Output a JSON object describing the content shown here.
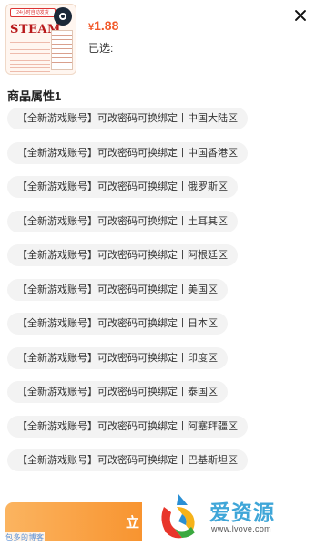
{
  "header": {
    "thumb_banner": "24小时自动发货",
    "thumb_title": "STEAM",
    "price_symbol": "¥",
    "price_value": "1.88",
    "selected_label": "已选:"
  },
  "attributes": {
    "title": "商品属性1",
    "options": [
      "【全新游戏账号】可改密码可换绑定丨中国大陆区",
      "【全新游戏账号】可改密码可换绑定丨中国香港区",
      "【全新游戏账号】可改密码可换绑定丨俄罗斯区",
      "【全新游戏账号】可改密码可换绑定丨土耳其区",
      "【全新游戏账号】可改密码可换绑定丨阿根廷区",
      "【全新游戏账号】可改密码可换绑定丨美国区",
      "【全新游戏账号】可改密码可换绑定丨日本区",
      "【全新游戏账号】可改密码可换绑定丨印度区",
      "【全新游戏账号】可改密码可换绑定丨泰国区",
      "【全新游戏账号】可改密码可换绑定丨阿塞拜疆区",
      "【全新游戏账号】可改密码可换绑定丨巴基斯坦区"
    ]
  },
  "footer": {
    "buy_label": "立",
    "watermark_left": "包多的博客",
    "watermark_brand": "爱资源",
    "watermark_url": "www.lvove.com"
  },
  "colors": {
    "price": "#f1592a",
    "button_gradient_start": "#fbb460",
    "button_gradient_end": "#f89430",
    "chip_bg": "#f3f3f3",
    "watermark_blue": "#3fa6d8"
  }
}
